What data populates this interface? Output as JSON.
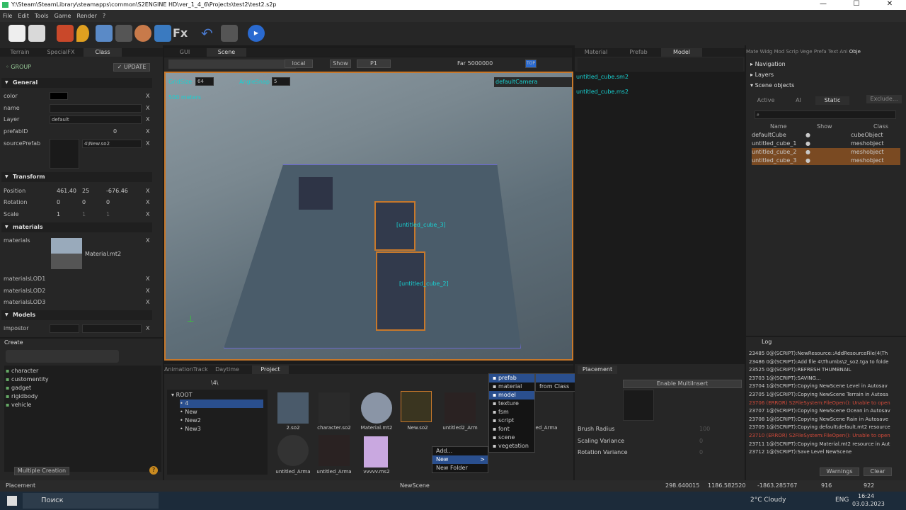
{
  "title": "Y:\\Steam\\SteamLibrary\\steamapps\\common\\S2ENGINE HD\\ver_1_4_6\\Projects\\test2\\test2.s2p",
  "window_controls": {
    "min": "—",
    "max": "☐",
    "close": "✕"
  },
  "menu": [
    "File",
    "Edit",
    "Tools",
    "Game",
    "Render",
    "?"
  ],
  "toolbar": {
    "fx": "Fx"
  },
  "left_tabs": [
    "Terrain",
    "SpecialFX",
    "Class"
  ],
  "group": {
    "label": "GROUP",
    "update": "UPDATE"
  },
  "general": {
    "header": "General",
    "color": "color",
    "name": "name",
    "layer": "Layer",
    "layer_value": "default",
    "prefabid": "prefabID",
    "prefabid_value": "0",
    "sourceprefab": "sourcePrefab",
    "sourceprefab_value": "4\\New.so2"
  },
  "transform": {
    "header": "Transform",
    "position": "Position",
    "pos": [
      "461.40",
      "25",
      "-676.46"
    ],
    "rotation": "Rotation",
    "rot": [
      "0",
      "0",
      "0"
    ],
    "scale": "Scale",
    "scl": [
      "1",
      "1",
      "1"
    ],
    "c": "c",
    "p": "p"
  },
  "materials": {
    "header": "materials",
    "materials": "materials",
    "mat_name": "Material.mt2",
    "lod1": "materialsLOD1",
    "lod2": "materialsLOD2",
    "lod3": "materialsLOD3"
  },
  "models": {
    "header": "Models",
    "impostor": "impostor"
  },
  "x": "X",
  "create": {
    "header": "Create",
    "items": [
      "character",
      "customentity",
      "gadget",
      "rigidbody",
      "vehicle"
    ],
    "multiple": "Multiple Creation",
    "help": "?"
  },
  "center_tabs": [
    "GUI",
    "Scene"
  ],
  "vp_toolbar": {
    "local": "local",
    "show": "Show",
    "p1": "P1",
    "far": "Far 5000000",
    "top": "TOP"
  },
  "viewport": {
    "gridsize": "GridSize",
    "gridsize_value": "64",
    "anglesnap": "AngleSnap",
    "anglesnap_value": "5",
    "meters": "500 meters",
    "camera": "defaultCamera",
    "cube3": "[untitled_cube_3]",
    "cube2": "[untitled_cube_2]"
  },
  "bottom_tabs": [
    "AnimationTrack",
    "Daytime",
    "Project"
  ],
  "project": {
    "path": "\\4\\",
    "tree": [
      "ROOT",
      "4",
      "New",
      "New2",
      "New3"
    ],
    "assets": [
      "2.so2",
      "character.so2",
      "Material.mt2",
      "New.so2",
      "untitled2_Arm",
      "untitled_Arma",
      "untitled_Arma",
      "vvvvv.ms2"
    ],
    "partial": "ed_Arma"
  },
  "context": {
    "add": "Add...",
    "new": "New",
    "newfolder": "New Folder",
    "arrow": ">"
  },
  "newmenu": [
    "prefab",
    "material",
    "model",
    "texture",
    "fsm",
    "script",
    "font",
    "scene",
    "vegetation"
  ],
  "frommenu": {
    "fromclass": "from Class"
  },
  "model_tabs": [
    "Material",
    "Prefab",
    "Model"
  ],
  "model_files": [
    "untitled_cube.sm2",
    "untitled_cube.ms2"
  ],
  "placement": {
    "tab": "Placement",
    "enable": "Enable MultiInsert",
    "brush": "Brush Radius",
    "brush_value": "100",
    "scaling": "Scaling Variance",
    "scaling_value": "0",
    "rotation": "Rotation Variance",
    "rotation_value": "0"
  },
  "right_tabs": [
    "Mate",
    "Widg",
    "Mod",
    "Scrip",
    "Vege",
    "Prefa",
    "Text",
    "Ani",
    "Obje"
  ],
  "navigation": "Navigation",
  "layers": "Layers",
  "scene_objects": "Scene objects",
  "obj_tabs": [
    "Active",
    "AI",
    "Static",
    "Exclude..."
  ],
  "obj_cols": [
    "Name",
    "Show",
    "Class"
  ],
  "objects": [
    {
      "name": "defaultCube",
      "cls": "cubeObject",
      "sel": false
    },
    {
      "name": "untitled_cube_1",
      "cls": "meshobject",
      "sel": false
    },
    {
      "name": "untitled_cube_2",
      "cls": "meshobject",
      "sel": true
    },
    {
      "name": "untitled_cube_3",
      "cls": "meshobject",
      "sel": true
    }
  ],
  "log": {
    "tab": "Log",
    "lines": [
      {
        "t": "23485 0@(SCRIPT):NewResource::AddResourceFile(4\\Th",
        "e": false
      },
      {
        "t": "23486 0@(SCRIPT):Add file 4\\Thumbs\\2_so2.tga to folde",
        "e": false
      },
      {
        "t": "23525 0@(SCRIPT):REFRESH THUMBNAIL",
        "e": false
      },
      {
        "t": "23703 1@(SCRIPT):SAVING...",
        "e": false
      },
      {
        "t": "23704 1@(SCRIPT):Copying NewScene Level in Autosav",
        "e": false
      },
      {
        "t": "23705 1@(SCRIPT):Copying NewScene Terrain in Autosa",
        "e": false
      },
      {
        "t": "23706 (ERROR) S2FileSystem:FileOpen(): Unable to open",
        "e": true
      },
      {
        "t": "23707 1@(SCRIPT):Copying NewScene Ocean in Autosav",
        "e": false
      },
      {
        "t": "23708 1@(SCRIPT):Copying NewScene Rain in Autosave",
        "e": false
      },
      {
        "t": "23709 1@(SCRIPT):Copying default\\default.mt2 resource",
        "e": false
      },
      {
        "t": "23710 (ERROR) S2FileSystem:FileOpen(): Unable to open",
        "e": true
      },
      {
        "t": "23711 1@(SCRIPT):Copying Material.mt2 resource in Aut",
        "e": false
      },
      {
        "t": "23712 1@(SCRIPT):Save Level NewScene",
        "e": false
      }
    ],
    "warnings": "Warnings",
    "clear": "Clear"
  },
  "status": {
    "left": "Placement",
    "scene": "NewScene",
    "x": "298.640015",
    "y": "1186.582520",
    "z": "-1863.285767",
    "a": "916",
    "b": "922"
  },
  "taskbar": {
    "search": "Поиск",
    "weather": "2°C  Cloudy",
    "lang": "ENG",
    "time": "16:24",
    "date": "03.03.2023"
  },
  "colors": {
    "accent": "#c7782b",
    "cyan": "#18d2d2",
    "select": "#7a4a22"
  }
}
